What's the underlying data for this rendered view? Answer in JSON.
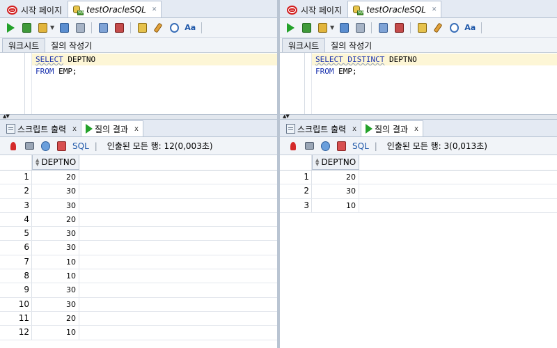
{
  "colors": {
    "accent": "#1d56a8",
    "keyword": "#1d35b0",
    "run_green": "#23a12a",
    "oracle_red": "#d21c1c",
    "highlight_line": "#fdf6d6"
  },
  "panels": [
    {
      "doc_tabs": [
        {
          "label": "시작 페이지",
          "icon": "oracle-icon"
        },
        {
          "label": "testOracleSQL",
          "icon": "db-connection-icon"
        }
      ],
      "sub_tabs": [
        "워크시트",
        "질의 작성기"
      ],
      "code": {
        "line1_kw": "SELECT",
        "line1_rest": " DEPTNO",
        "line2_kw": "FROM",
        "line2_rest": " EMP;"
      },
      "result_tabs": [
        "스크립트 출력",
        "질의 결과"
      ],
      "result_toolbar": {
        "sql_label": "SQL",
        "status": "인출된 모든 행: 12(0,003초)"
      },
      "grid": {
        "column": "DEPTNO",
        "rows": [
          {
            "n": "1",
            "v": "20"
          },
          {
            "n": "2",
            "v": "30"
          },
          {
            "n": "3",
            "v": "30"
          },
          {
            "n": "4",
            "v": "20"
          },
          {
            "n": "5",
            "v": "30"
          },
          {
            "n": "6",
            "v": "30"
          },
          {
            "n": "7",
            "v": "10"
          },
          {
            "n": "8",
            "v": "10"
          },
          {
            "n": "9",
            "v": "30"
          },
          {
            "n": "10",
            "v": "30"
          },
          {
            "n": "11",
            "v": "20"
          },
          {
            "n": "12",
            "v": "10"
          }
        ]
      }
    },
    {
      "doc_tabs": [
        {
          "label": "시작 페이지",
          "icon": "oracle-icon"
        },
        {
          "label": "testOracleSQL",
          "icon": "db-connection-icon"
        }
      ],
      "sub_tabs": [
        "워크시트",
        "질의 작성기"
      ],
      "code": {
        "line1_kw": "SELECT DISTINCT",
        "line1_rest": " DEPTNO",
        "line2_kw": "FROM",
        "line2_rest": " EMP;"
      },
      "result_tabs": [
        "스크립트 출력",
        "질의 결과"
      ],
      "result_toolbar": {
        "sql_label": "SQL",
        "status": "인출된 모든 행: 3(0,013초)"
      },
      "grid": {
        "column": "DEPTNO",
        "rows": [
          {
            "n": "1",
            "v": "20"
          },
          {
            "n": "2",
            "v": "30"
          },
          {
            "n": "3",
            "v": "10"
          }
        ]
      }
    }
  ]
}
